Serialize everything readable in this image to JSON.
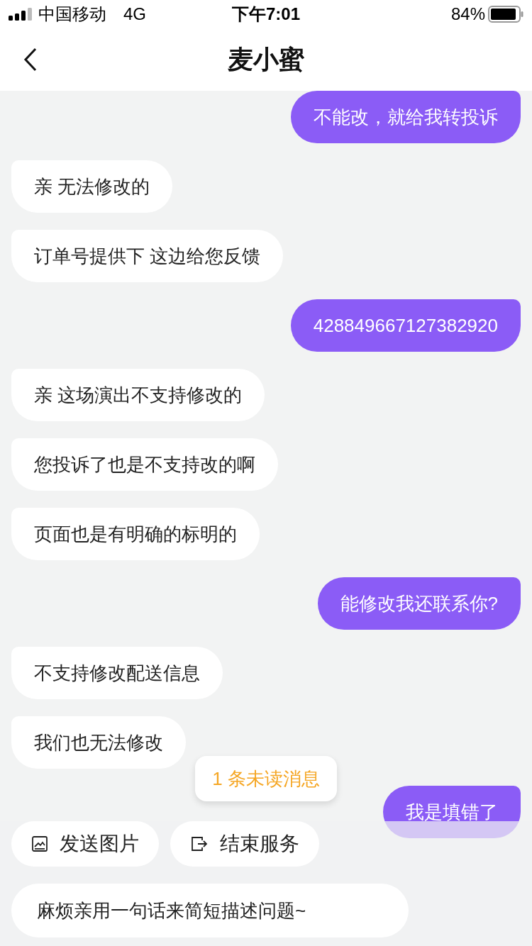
{
  "status_bar": {
    "carrier": "中国移动",
    "network": "4G",
    "time": "下午7:01",
    "battery": "84%"
  },
  "header": {
    "title": "麦小蜜"
  },
  "messages": [
    {
      "kind": "user",
      "text": "不能改，就给我转投诉"
    },
    {
      "kind": "agent",
      "text": "亲 无法修改的"
    },
    {
      "kind": "agent",
      "text": "订单号提供下 这边给您反馈"
    },
    {
      "kind": "user",
      "text": "428849667127382920"
    },
    {
      "kind": "agent",
      "text": "亲 这场演出不支持修改的"
    },
    {
      "kind": "agent",
      "text": "您投诉了也是不支持改的啊"
    },
    {
      "kind": "agent",
      "text": "页面也是有明确的标明的"
    },
    {
      "kind": "user",
      "text": "能修改我还联系你?"
    },
    {
      "kind": "agent",
      "text": "不支持修改配送信息"
    },
    {
      "kind": "agent",
      "text": "我们也无法修改"
    },
    {
      "kind": "user",
      "text": "我是填错了"
    }
  ],
  "unread_badge": "1 条未读消息",
  "quick_actions": [
    {
      "kind": "image",
      "label": "发送图片"
    },
    {
      "kind": "exit",
      "label": "结束服务"
    }
  ],
  "input": {
    "placeholder": "麻烦亲用一句话来简短描述问题~"
  }
}
